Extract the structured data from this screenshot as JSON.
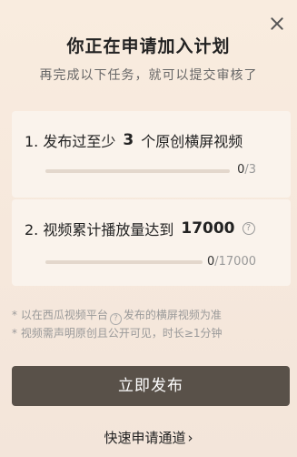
{
  "header": {
    "title": "你正在申请加入计划",
    "subtitle": "再完成以下任务，就可以提交审核了"
  },
  "tasks": [
    {
      "prefix": "1. 发布过至少",
      "number": "3",
      "suffix": "个原创横屏视频",
      "current": "0",
      "total": "/3",
      "progress_fraction": 0
    },
    {
      "prefix": "2. 视频累计播放量达到",
      "number": "17000",
      "current": "0",
      "total": "/17000",
      "progress_fraction": 0
    }
  ],
  "notes": {
    "line1_a": "* 以在西瓜视频平台",
    "line1_b": "发布的横屏视频为准",
    "line2": "* 视频需声明原创且公开可见，时长≥1分钟"
  },
  "buttons": {
    "publish": "立即发布",
    "fast_channel": "快速申请通道",
    "fast_channel_chevron": "›"
  },
  "icons": {
    "help": "?",
    "close": "close-icon"
  },
  "colors": {
    "button_bg": "#595149",
    "progress_fill": "#d9a27a"
  }
}
